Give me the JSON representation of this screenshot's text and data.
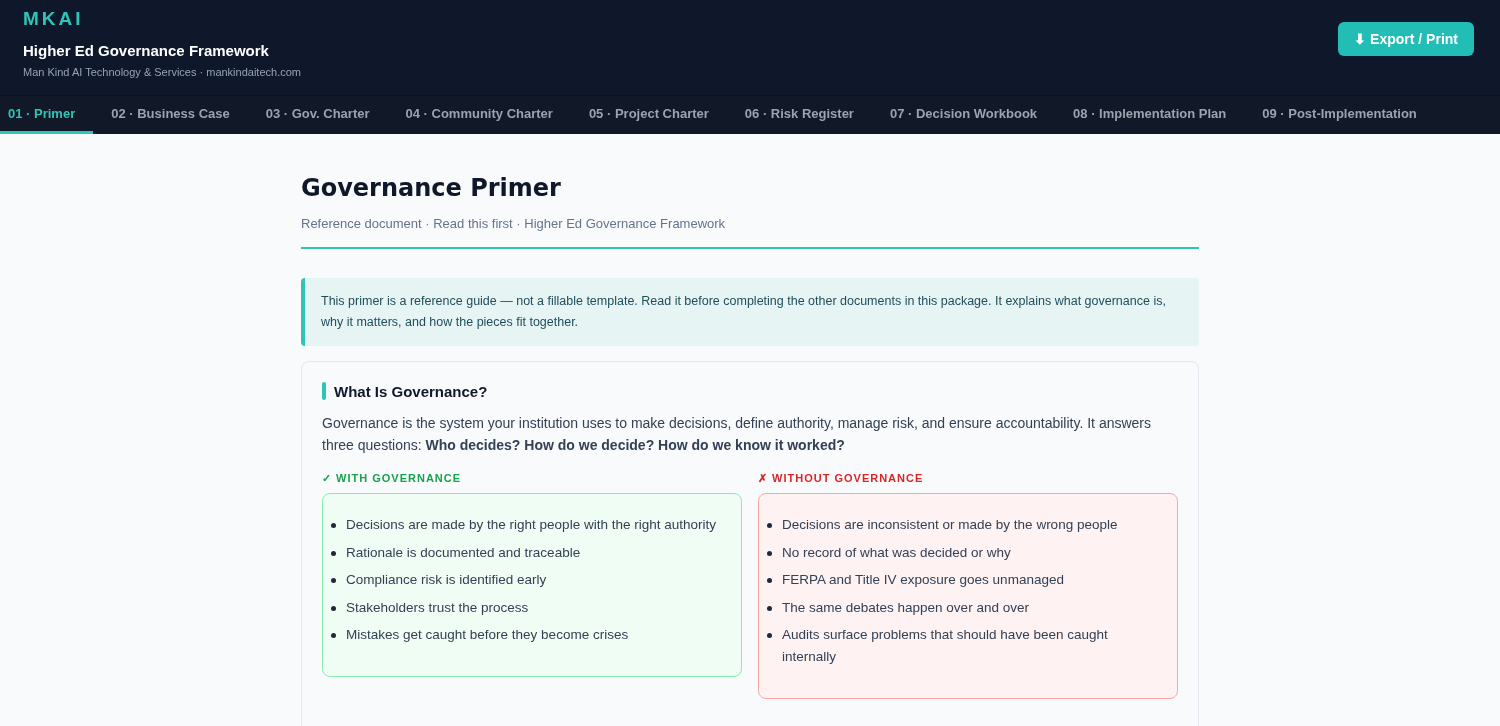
{
  "header": {
    "logo": "MKAI",
    "title": "Higher Ed Governance Framework",
    "subtitle": "Man Kind AI Technology & Services · mankindaitech.com",
    "export_button": "⬇ Export / Print"
  },
  "tabs": [
    {
      "label": "01 · Primer",
      "selected": true
    },
    {
      "label": "02 · Business Case",
      "selected": false
    },
    {
      "label": "03 · Gov. Charter",
      "selected": false
    },
    {
      "label": "04 · Community Charter",
      "selected": false
    },
    {
      "label": "05 · Project Charter",
      "selected": false
    },
    {
      "label": "06 · Risk Register",
      "selected": false
    },
    {
      "label": "07 · Decision Workbook",
      "selected": false
    },
    {
      "label": "08 · Implementation Plan",
      "selected": false
    },
    {
      "label": "09 · Post-Implementation",
      "selected": false
    }
  ],
  "document": {
    "title": "Governance Primer",
    "meta": "Reference document · Read this first · Higher Ed Governance Framework",
    "note": "This primer is a reference guide — not a fillable template. Read it before completing the other documents in this package. It explains what governance is, why it matters, and how the pieces fit together.",
    "section": {
      "heading": "What Is Governance?",
      "intro": "Governance is the system your institution uses to make decisions, define authority, manage risk, and ensure accountability. It answers three questions: **Who decides? How do we decide? How do we know it worked?**",
      "columns": [
        {
          "kind": "pro",
          "label": "✓ WITH GOVERNANCE",
          "items": [
            "Decisions are made by the right people with the right authority",
            "Rationale is documented and traceable",
            "Compliance risk is identified early",
            "Stakeholders trust the process",
            "Mistakes get caught before they become crises"
          ]
        },
        {
          "kind": "con",
          "label": "✗ WITHOUT GOVERNANCE",
          "items": [
            "Decisions are inconsistent or made by the wrong people",
            "No record of what was decided or why",
            "FERPA and Title IV exposure goes unmanaged",
            "The same debates happen over and over",
            "Audits surface problems that should have been caught internally"
          ]
        }
      ]
    }
  }
}
